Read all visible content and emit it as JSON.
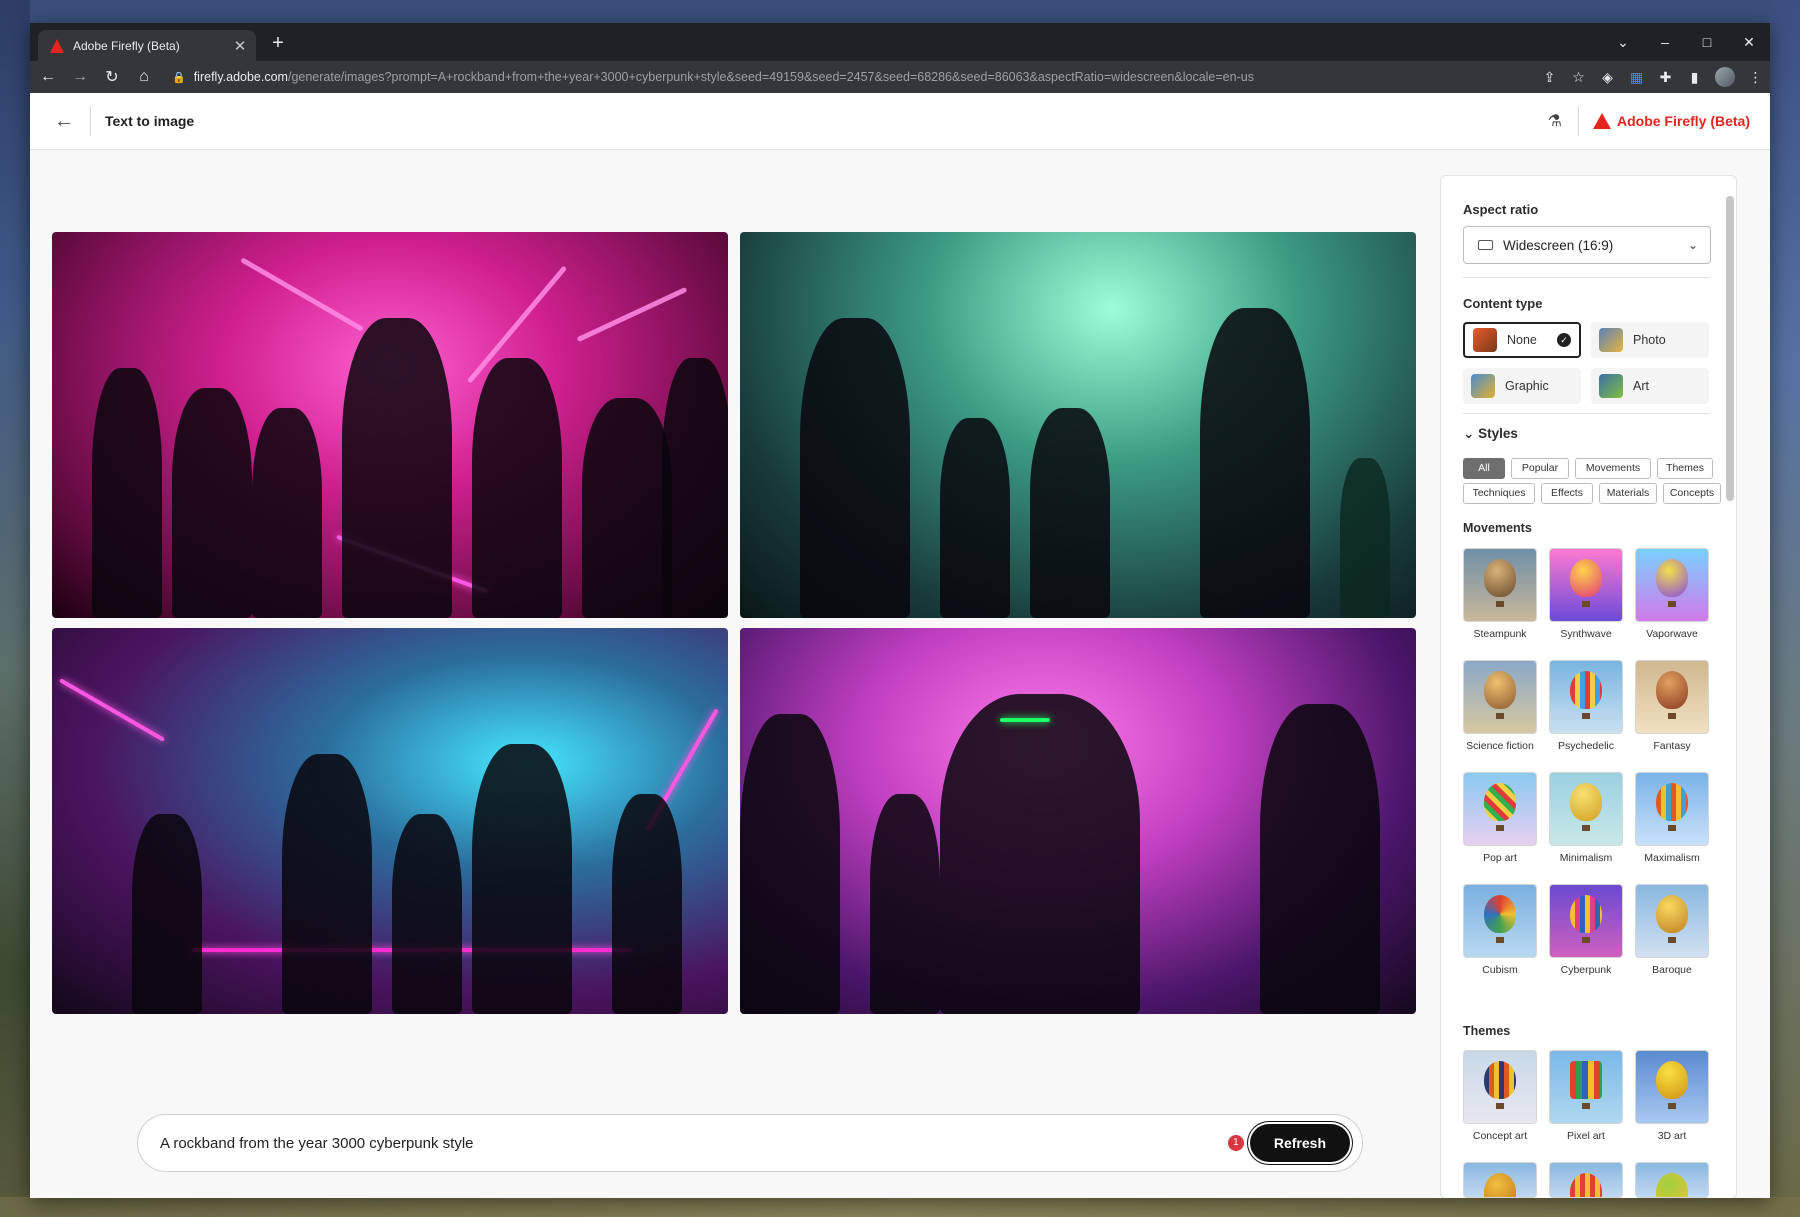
{
  "browser": {
    "tab_title": "Adobe Firefly (Beta)",
    "tab_close": "✕",
    "new_tab": "+",
    "url_domain": "firefly.adobe.com",
    "url_path": "/generate/images?prompt=A+rockband+from+the+year+3000+cyberpunk+style&seed=49159&seed=2457&seed=68286&seed=86063&aspectRatio=widescreen&locale=en-us"
  },
  "header": {
    "page_title": "Text to image",
    "brand": "Adobe Firefly (Beta)"
  },
  "prompt": {
    "text": "A rockband from the year 3000 cyberpunk style",
    "badge": "1",
    "refresh_label": "Refresh"
  },
  "panel": {
    "aspect_ratio_label": "Aspect ratio",
    "aspect_ratio_value": "Widescreen (16:9)",
    "content_type_label": "Content type",
    "content_types": [
      {
        "label": "None",
        "selected": true
      },
      {
        "label": "Photo"
      },
      {
        "label": "Graphic"
      },
      {
        "label": "Art"
      }
    ],
    "styles_label": "Styles",
    "style_filters": [
      "All",
      "Popular",
      "Movements",
      "Themes",
      "Techniques",
      "Effects",
      "Materials",
      "Concepts"
    ],
    "movements_label": "Movements",
    "movements": [
      "Steampunk",
      "Synthwave",
      "Vaporwave",
      "Science fiction",
      "Psychedelic",
      "Fantasy",
      "Pop art",
      "Minimalism",
      "Maximalism",
      "Cubism",
      "Cyberpunk",
      "Baroque"
    ],
    "themes_label": "Themes",
    "themes": [
      "Concept art",
      "Pixel art",
      "3D art"
    ]
  },
  "colors": {
    "brand_red": "#e3261c",
    "refresh_bg": "#111111",
    "chip_active": "#6e6e6e"
  }
}
